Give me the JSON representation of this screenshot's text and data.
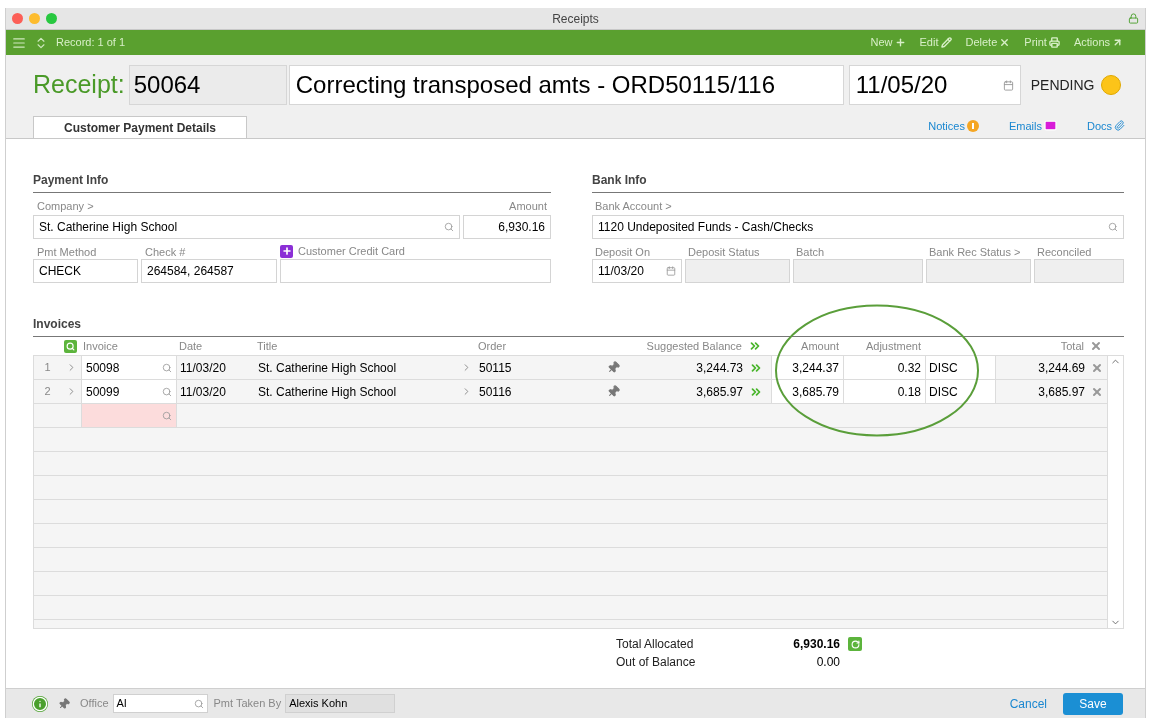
{
  "window": {
    "title": "Receipts"
  },
  "toolbar": {
    "record": "Record: 1 of 1",
    "actions": [
      {
        "kind": "new",
        "label": "New"
      },
      {
        "kind": "edit",
        "label": "Edit"
      },
      {
        "kind": "delete",
        "label": "Delete"
      },
      {
        "kind": "print",
        "label": "Print"
      },
      {
        "kind": "actions",
        "label": "Actions"
      }
    ]
  },
  "header": {
    "label": "Receipt:",
    "number": "50064",
    "title": "Correcting transposed amts - ORD50115/116",
    "date": "11/05/20",
    "status": "PENDING"
  },
  "tabs": [
    {
      "label": "Customer Payment Details",
      "selected": true
    }
  ],
  "links": [
    {
      "kind": "notices",
      "label": "Notices"
    },
    {
      "kind": "emails",
      "label": "Emails"
    },
    {
      "kind": "docs",
      "label": "Docs"
    }
  ],
  "payment_info": {
    "heading": "Payment Info",
    "company": {
      "label": "Company >",
      "value": "St. Catherine High School"
    },
    "amount": {
      "label": "Amount",
      "value": "6,930.16"
    },
    "pmt_method": {
      "label": "Pmt Method",
      "value": "CHECK"
    },
    "check_number": {
      "label": "Check #",
      "value": "264584, 264587"
    },
    "credit_card": {
      "label": "Customer Credit Card"
    }
  },
  "bank_info": {
    "heading": "Bank Info",
    "bank_account": {
      "label": "Bank Account >",
      "value": "1120 Undeposited Funds - Cash/Checks"
    },
    "deposit_on": {
      "label": "Deposit On",
      "value": "11/03/20"
    },
    "deposit_status": {
      "label": "Deposit Status",
      "disabled": true
    },
    "batch": {
      "label": "Batch",
      "disabled": true
    },
    "bank_rec_status": {
      "label": "Bank Rec Status >",
      "disabled": true
    },
    "reconciled": {
      "label": "Reconciled",
      "disabled": true
    }
  },
  "invoices": {
    "heading": "Invoices",
    "columns": [
      "Invoice",
      "Date",
      "Title",
      "Order",
      "Suggested Balance",
      "Amount",
      "Adjustment",
      "Total"
    ],
    "rows": [
      {
        "number": "1",
        "invoice": "50098",
        "date": "11/03/20",
        "title": "St. Catherine High School",
        "order": "50115",
        "suggested_balance": "3,244.73",
        "amount": "3,244.37",
        "adjustment": "0.32",
        "adjustment_code": "DISC",
        "total": "3,244.69"
      },
      {
        "number": "2",
        "invoice": "50099",
        "date": "11/03/20",
        "title": "St. Catherine High School",
        "order": "50116",
        "suggested_balance": "3,685.97",
        "amount": "3,685.79",
        "adjustment": "0.18",
        "adjustment_code": "DISC",
        "total": "3,685.97"
      }
    ],
    "new_row_required": true
  },
  "totals": [
    {
      "kind": "allocated",
      "label": "Total Allocated",
      "value": "6,930.16"
    },
    {
      "kind": "balance",
      "label": "Out of Balance",
      "value": "0.00"
    }
  ],
  "footer": {
    "office": {
      "label": "Office",
      "value": "AI"
    },
    "taken_by": {
      "label": "Pmt Taken By",
      "value": "Alexis Kohn"
    },
    "buttons": [
      "Cancel",
      "Save"
    ]
  }
}
